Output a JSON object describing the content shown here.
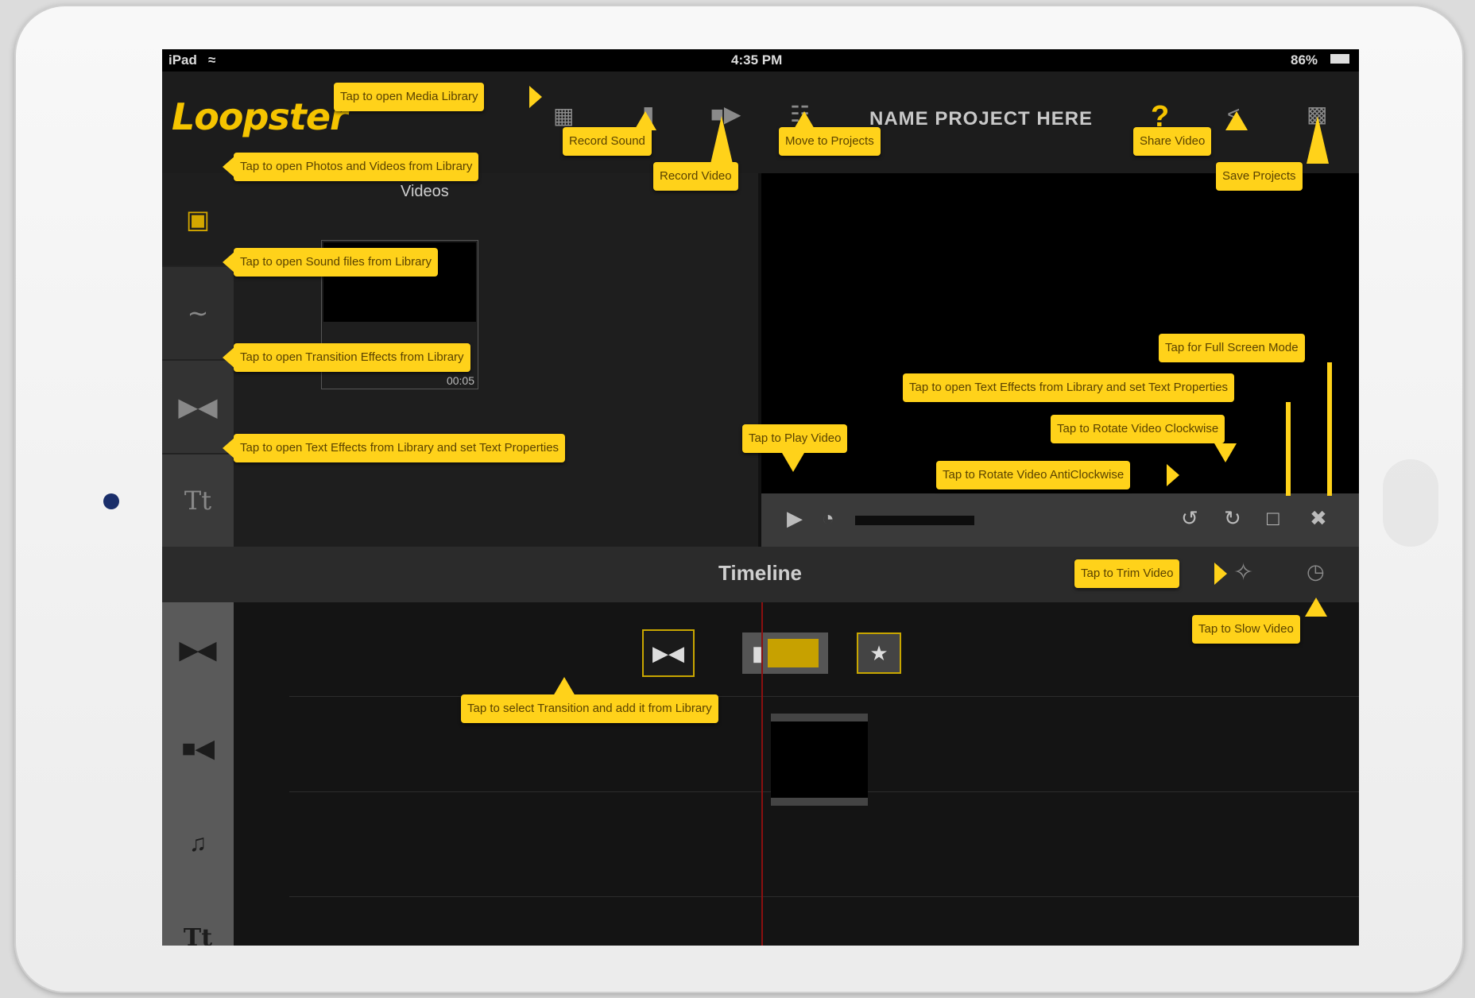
{
  "status_bar": {
    "device": "iPad",
    "wifi_icon": "wifi-icon",
    "time": "4:35 PM",
    "battery": "86%"
  },
  "app": {
    "logo": "Loopster"
  },
  "toolbar": {
    "project_title": "NAME PROJECT HERE",
    "help_label": "?"
  },
  "media_panel": {
    "section_label": "Videos",
    "thumb_duration": "00:05"
  },
  "timeline": {
    "title": "Timeline"
  },
  "callouts": {
    "open_media_library": "Tap to open Media Library",
    "record_sound": "Record Sound",
    "record_video": "Record Video",
    "move_to_projects": "Move to Projects",
    "share_video": "Share Video",
    "save_projects": "Save Projects",
    "open_photos_videos": "Tap to open Photos and Videos from Library",
    "open_sound_files": "Tap to open Sound files from Library",
    "open_transitions": "Tap to open Transition Effects from Library",
    "open_text_effects_left": "Tap to open Text Effects  from Library and set Text Properties",
    "full_screen": "Tap for Full Screen Mode",
    "open_text_effects_right": "Tap to open Text Effects  from Library and set Text Properties",
    "rotate_clockwise": "Tap to Rotate Video Clockwise",
    "play_video": "Tap to Play Video",
    "rotate_anticlockwise": "Tap to Rotate Video AntiClockwise",
    "trim_video": "Tap to Trim Video",
    "slow_video": "Tap to Slow Video",
    "select_transition": "Tap to select Transition and add it from Library"
  },
  "colors": {
    "accent": "#f5c400",
    "callout": "#ffd21a",
    "background": "#111111"
  }
}
